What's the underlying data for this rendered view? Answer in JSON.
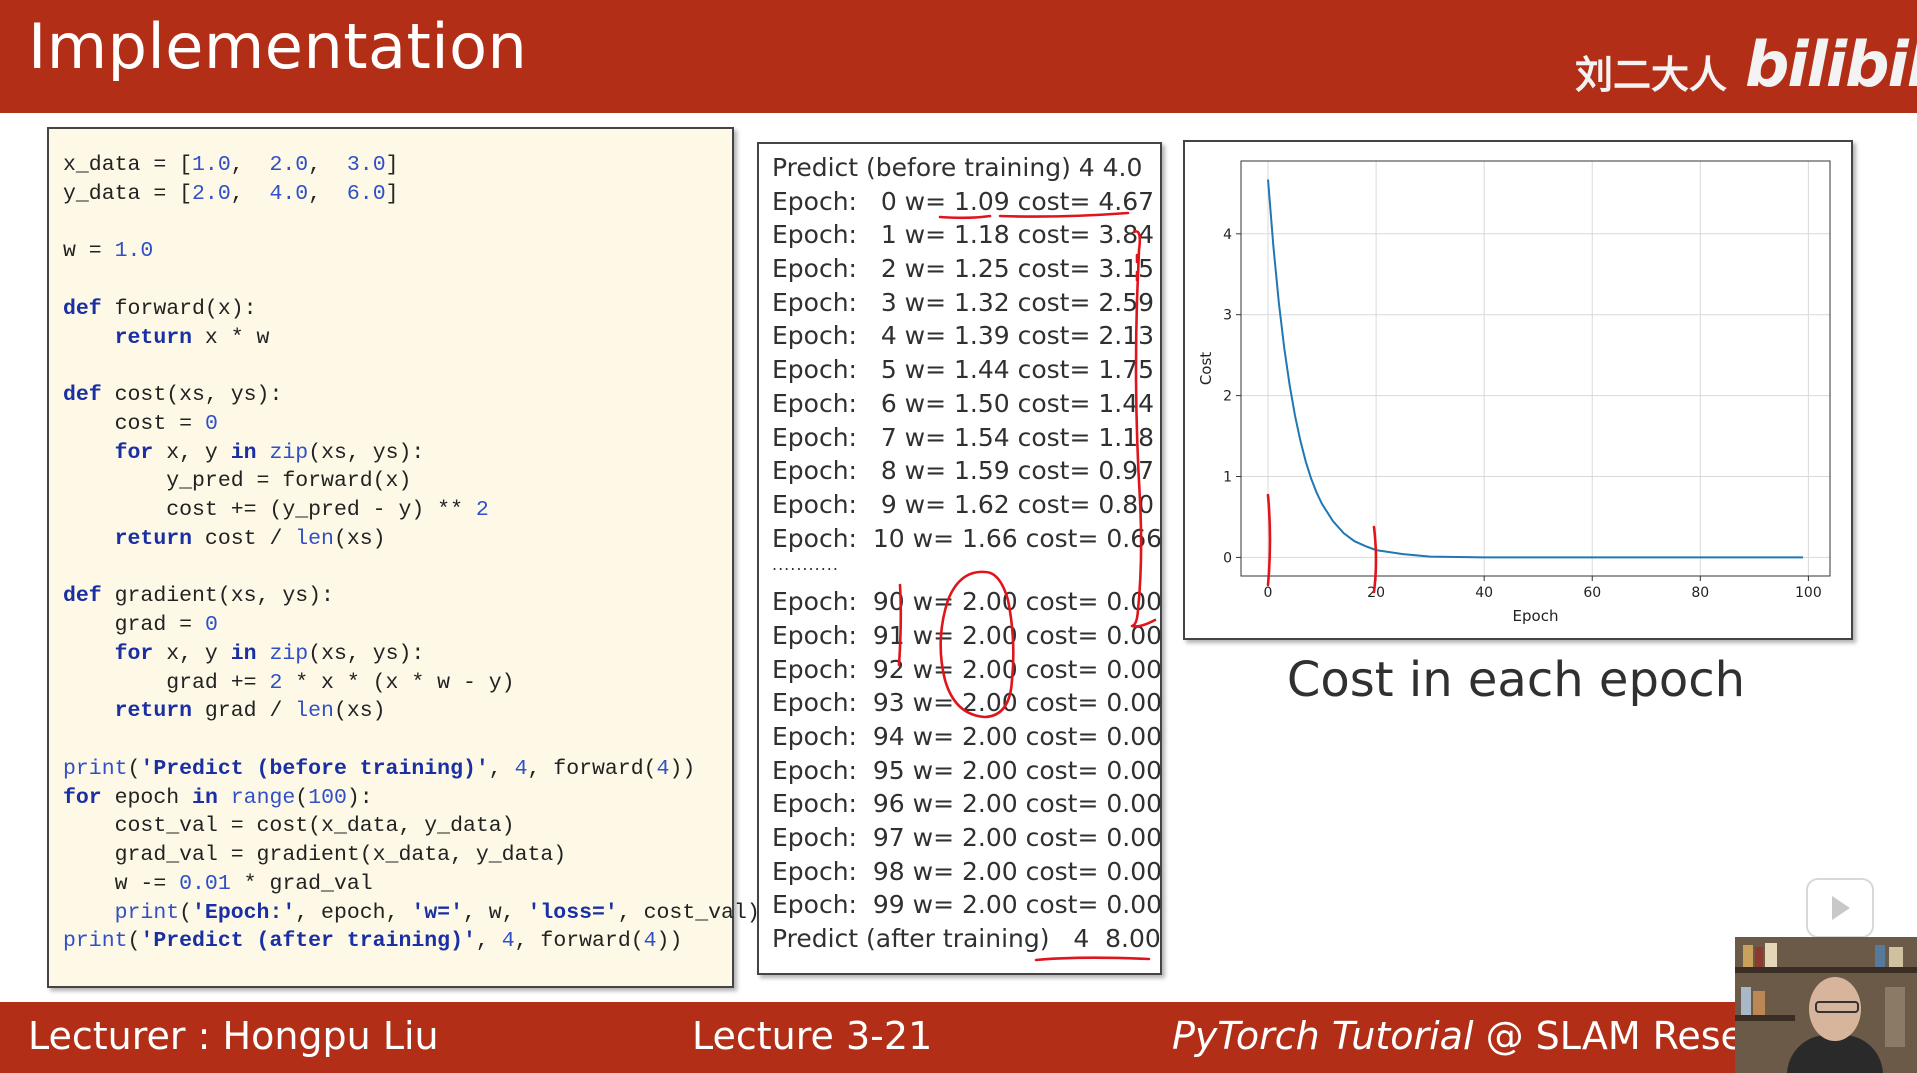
{
  "header": {
    "title": "Implementation",
    "channel": "刘二大人",
    "logo_text": "bilibili"
  },
  "code": {
    "lines": [
      [
        [
          "x_data = [",
          ""
        ],
        [
          "1.0",
          "num"
        ],
        [
          ",  ",
          ""
        ],
        [
          "2.0",
          "num"
        ],
        [
          ",  ",
          ""
        ],
        [
          "3.0",
          "num"
        ],
        [
          "]",
          ""
        ]
      ],
      [
        [
          "y_data = [",
          ""
        ],
        [
          "2.0",
          "num"
        ],
        [
          ",  ",
          ""
        ],
        [
          "4.0",
          "num"
        ],
        [
          ",  ",
          ""
        ],
        [
          "6.0",
          "num"
        ],
        [
          "]",
          ""
        ]
      ],
      [],
      [
        [
          "w = ",
          ""
        ],
        [
          "1.0",
          "num"
        ]
      ],
      [],
      [
        [
          "def",
          "kw"
        ],
        [
          " forward(x):",
          ""
        ]
      ],
      [
        [
          "    ",
          ""
        ],
        [
          "return",
          "kw"
        ],
        [
          " x * w",
          ""
        ]
      ],
      [],
      [
        [
          "def",
          "kw"
        ],
        [
          " cost(xs, ys):",
          ""
        ]
      ],
      [
        [
          "    cost = ",
          ""
        ],
        [
          "0",
          "num"
        ]
      ],
      [
        [
          "    ",
          ""
        ],
        [
          "for",
          "kw"
        ],
        [
          " x, y ",
          ""
        ],
        [
          "in",
          "kw"
        ],
        [
          " ",
          ""
        ],
        [
          "zip",
          "bi"
        ],
        [
          "(xs, ys):",
          ""
        ]
      ],
      [
        [
          "        y_pred = forward(x)",
          ""
        ]
      ],
      [
        [
          "        cost += (y_pred - y) ** ",
          ""
        ],
        [
          "2",
          "num"
        ]
      ],
      [
        [
          "    ",
          ""
        ],
        [
          "return",
          "kw"
        ],
        [
          " cost / ",
          ""
        ],
        [
          "len",
          "bi"
        ],
        [
          "(xs)",
          ""
        ]
      ],
      [],
      [
        [
          "def",
          "kw"
        ],
        [
          " gradient(xs, ys):",
          ""
        ]
      ],
      [
        [
          "    grad = ",
          ""
        ],
        [
          "0",
          "num"
        ]
      ],
      [
        [
          "    ",
          ""
        ],
        [
          "for",
          "kw"
        ],
        [
          " x, y ",
          ""
        ],
        [
          "in",
          "kw"
        ],
        [
          " ",
          ""
        ],
        [
          "zip",
          "bi"
        ],
        [
          "(xs, ys):",
          ""
        ]
      ],
      [
        [
          "        grad += ",
          ""
        ],
        [
          "2",
          "num"
        ],
        [
          " * x * (x * w - y)",
          ""
        ]
      ],
      [
        [
          "    ",
          ""
        ],
        [
          "return",
          "kw"
        ],
        [
          " grad / ",
          ""
        ],
        [
          "len",
          "bi"
        ],
        [
          "(xs)",
          ""
        ]
      ],
      [],
      [
        [
          "print",
          "bi"
        ],
        [
          "(",
          ""
        ],
        [
          "'Predict (before training)'",
          "str"
        ],
        [
          ", ",
          ""
        ],
        [
          "4",
          "num"
        ],
        [
          ", forward(",
          ""
        ],
        [
          "4",
          "num"
        ],
        [
          "))",
          ""
        ]
      ],
      [
        [
          "for",
          "kw"
        ],
        [
          " epoch ",
          ""
        ],
        [
          "in",
          "kw"
        ],
        [
          " ",
          ""
        ],
        [
          "range",
          "bi"
        ],
        [
          "(",
          ""
        ],
        [
          "100",
          "num"
        ],
        [
          "):",
          ""
        ]
      ],
      [
        [
          "    cost_val = cost(x_data, y_data)",
          ""
        ]
      ],
      [
        [
          "    grad_val = gradient(x_data, y_data)",
          ""
        ]
      ],
      [
        [
          "    w -= ",
          ""
        ],
        [
          "0.01",
          "num"
        ],
        [
          " * grad_val",
          ""
        ]
      ],
      [
        [
          "    ",
          ""
        ],
        [
          "print",
          "bi"
        ],
        [
          "(",
          ""
        ],
        [
          "'Epoch:'",
          "str"
        ],
        [
          ", epoch, ",
          ""
        ],
        [
          "'w='",
          "str"
        ],
        [
          ", w, ",
          ""
        ],
        [
          "'loss='",
          "str"
        ],
        [
          ", cost_val)",
          ""
        ]
      ],
      [
        [
          "print",
          "bi"
        ],
        [
          "(",
          ""
        ],
        [
          "'Predict (after training)'",
          "str"
        ],
        [
          ", ",
          ""
        ],
        [
          "4",
          "num"
        ],
        [
          ", forward(",
          ""
        ],
        [
          "4",
          "num"
        ],
        [
          "))",
          ""
        ]
      ]
    ]
  },
  "output": {
    "before": "Predict (before training) 4 4.0",
    "epochs_start": [
      "Epoch:   0 w= 1.09 cost= 4.67",
      "Epoch:   1 w= 1.18 cost= 3.84",
      "Epoch:   2 w= 1.25 cost= 3.15",
      "Epoch:   3 w= 1.32 cost= 2.59",
      "Epoch:   4 w= 1.39 cost= 2.13",
      "Epoch:   5 w= 1.44 cost= 1.75",
      "Epoch:   6 w= 1.50 cost= 1.44",
      "Epoch:   7 w= 1.54 cost= 1.18",
      "Epoch:   8 w= 1.59 cost= 0.97",
      "Epoch:   9 w= 1.62 cost= 0.80",
      "Epoch:  10 w= 1.66 cost= 0.66"
    ],
    "ellipsis": "...........",
    "epochs_end": [
      "Epoch:  90 w= 2.00 cost= 0.00",
      "Epoch:  91 w= 2.00 cost= 0.00",
      "Epoch:  92 w= 2.00 cost= 0.00",
      "Epoch:  93 w= 2.00 cost= 0.00",
      "Epoch:  94 w= 2.00 cost= 0.00",
      "Epoch:  95 w= 2.00 cost= 0.00",
      "Epoch:  96 w= 2.00 cost= 0.00",
      "Epoch:  97 w= 2.00 cost= 0.00",
      "Epoch:  98 w= 2.00 cost= 0.00",
      "Epoch:  99 w= 2.00 cost= 0.00"
    ],
    "after": "Predict (after training)   4  8.00"
  },
  "chart_data": {
    "type": "line",
    "title": "",
    "xlabel": "Epoch",
    "ylabel": "Cost",
    "xlim": [
      -5,
      104
    ],
    "ylim": [
      -0.23,
      4.9
    ],
    "xticks": [
      0,
      20,
      40,
      60,
      80,
      100
    ],
    "yticks": [
      0,
      1,
      2,
      3,
      4
    ],
    "grid": true,
    "series": [
      {
        "color": "#1f77b4",
        "x": [
          0,
          1,
          2,
          3,
          4,
          5,
          6,
          7,
          8,
          9,
          10,
          12,
          14,
          16,
          18,
          20,
          25,
          30,
          40,
          50,
          60,
          70,
          80,
          90,
          99
        ],
        "y": [
          4.67,
          3.84,
          3.15,
          2.59,
          2.13,
          1.75,
          1.44,
          1.18,
          0.97,
          0.8,
          0.66,
          0.45,
          0.3,
          0.2,
          0.14,
          0.09,
          0.04,
          0.01,
          0.0,
          0.0,
          0.0,
          0.0,
          0.0,
          0.0,
          0.0
        ]
      }
    ]
  },
  "chart_caption": "Cost in each epoch",
  "footer": {
    "lecturer": "Lecturer : Hongpu Liu",
    "lecture": "Lecture 3-21",
    "course_italic": "PyTorch Tutorial",
    "course_rest": " @ SLAM Resear"
  },
  "colors": {
    "accent": "#b32e17",
    "annotation": "#e0151b",
    "code_bg": "#fdf9e6"
  },
  "icons": {
    "play": "play-icon"
  }
}
